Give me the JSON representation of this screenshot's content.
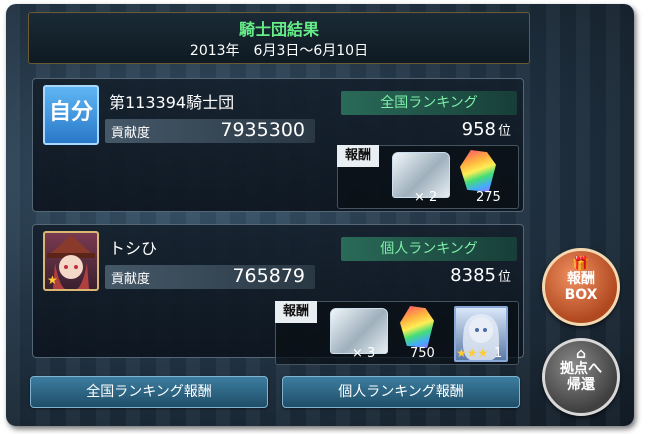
{
  "header": {
    "title": "騎士団結果",
    "dates": "2013年　6月3日〜6月10日"
  },
  "guild": {
    "badge": "自分",
    "name": "第113394騎士団",
    "contribution_label": "貢献度",
    "contribution_value": "7935300",
    "ranking_label": "全国ランキング",
    "rank": "958",
    "rank_unit": "位",
    "reward_label": "報酬",
    "rewards": [
      {
        "icon": "treasure-chest-icon",
        "count": "× 2"
      },
      {
        "icon": "rainbow-crystal-icon",
        "count": "275"
      }
    ]
  },
  "player": {
    "name": "トシひ",
    "contribution_label": "貢献度",
    "contribution_value": "765879",
    "ranking_label": "個人ランキング",
    "rank": "8385",
    "rank_unit": "位",
    "reward_label": "報酬",
    "rewards": [
      {
        "icon": "treasure-chest-icon",
        "count": "× 3"
      },
      {
        "icon": "rainbow-crystal-icon",
        "count": "750"
      },
      {
        "icon": "character-card-icon",
        "count": "1"
      }
    ]
  },
  "buttons": {
    "national_reward": "全国ランキング報酬",
    "personal_reward": "個人ランキング報酬",
    "reward_box_line1": "報酬",
    "reward_box_line2": "BOX",
    "return_line1": "拠点へ",
    "return_line2": "帰還"
  },
  "colors": {
    "title_green": "#66ee88",
    "ranking_green": "#7ef0a8",
    "button_blue": "#2f6a8a",
    "reward_box_orange": "#c85a2a"
  }
}
